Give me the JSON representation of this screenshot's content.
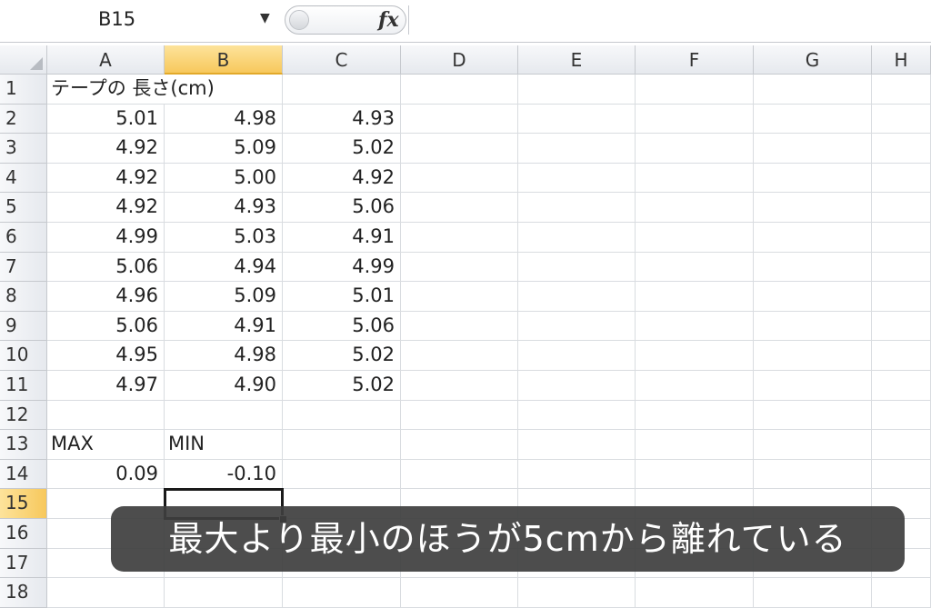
{
  "formula_bar": {
    "name_box": "B15",
    "fx_label": "fx",
    "formula": ""
  },
  "columns": [
    "A",
    "B",
    "C",
    "D",
    "E",
    "F",
    "G",
    "H"
  ],
  "active_column": "B",
  "rows": [
    "1",
    "2",
    "3",
    "4",
    "5",
    "6",
    "7",
    "8",
    "9",
    "10",
    "11",
    "12",
    "13",
    "14",
    "15",
    "16",
    "17",
    "18"
  ],
  "active_row": "15",
  "cells": {
    "A1": "テープの 長さ(cm)",
    "A2": "5.01",
    "B2": "4.98",
    "C2": "4.93",
    "A3": "4.92",
    "B3": "5.09",
    "C3": "5.02",
    "A4": "4.92",
    "B4": "5.00",
    "C4": "4.92",
    "A5": "4.92",
    "B5": "4.93",
    "C5": "5.06",
    "A6": "4.99",
    "B6": "5.03",
    "C6": "4.91",
    "A7": "5.06",
    "B7": "4.94",
    "C7": "4.99",
    "A8": "4.96",
    "B8": "5.09",
    "C8": "5.01",
    "A9": "5.06",
    "B9": "4.91",
    "C9": "5.06",
    "A10": "4.95",
    "B10": "4.98",
    "C10": "5.02",
    "A11": "4.97",
    "B11": "4.90",
    "C11": "5.02",
    "A13": "MAX",
    "B13": "MIN",
    "A14": "0.09",
    "B14": "-0.10"
  },
  "caption": "最大より最小のほうが5cmから離れている",
  "colors": {
    "header_active": "#f7c85c",
    "grid_line": "#d9dce0",
    "caption_bg": "#3e3e3e"
  },
  "icons": {
    "name_box_dropdown": "chevron-down-icon",
    "corner": "select-all-icon"
  }
}
